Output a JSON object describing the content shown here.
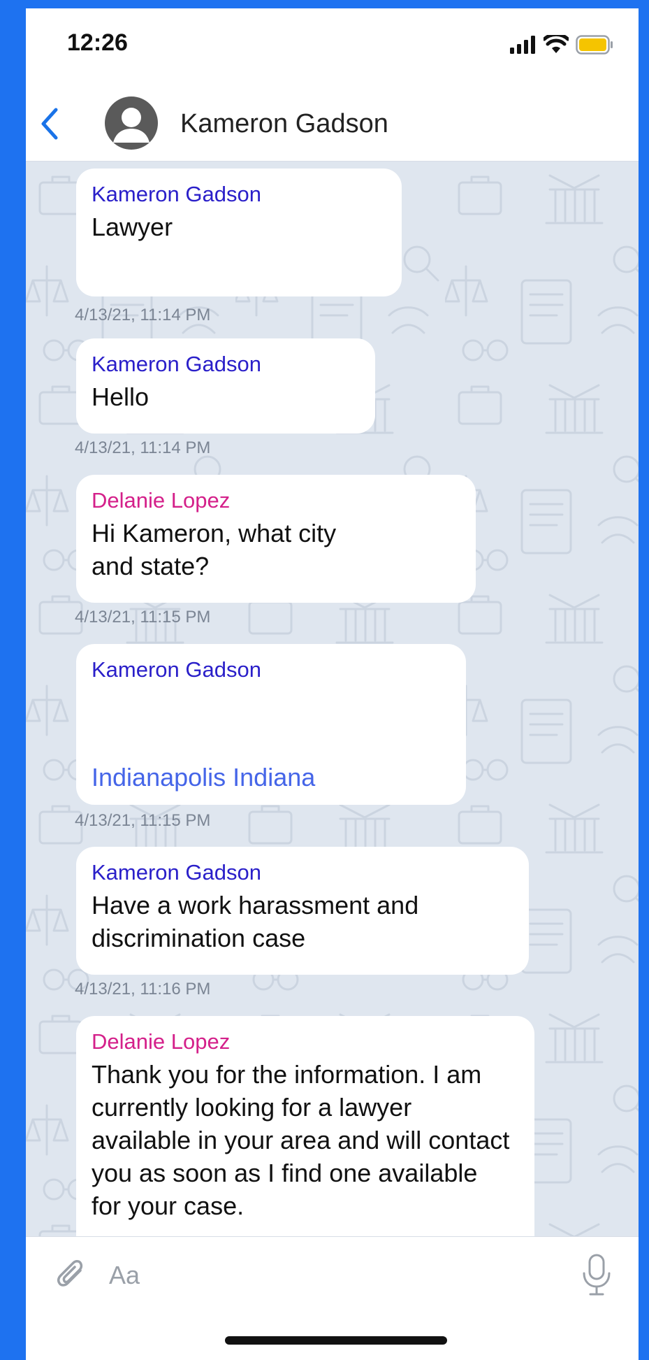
{
  "status_bar": {
    "time": "12:26"
  },
  "header": {
    "contact_name": "Kameron Gadson"
  },
  "messages": [
    {
      "sender": "Kameron Gadson",
      "text": "Lawyer",
      "timestamp": "4/13/21, 11:14 PM"
    },
    {
      "sender": "Kameron Gadson",
      "text": "Hello",
      "timestamp": "4/13/21, 11:14 PM"
    },
    {
      "sender": "Delanie Lopez",
      "text": "Hi Kameron, what city and state?",
      "timestamp": "4/13/21, 11:15 PM"
    },
    {
      "sender": "Kameron Gadson",
      "link_text": "Indianapolis Indiana",
      "timestamp": "4/13/21, 11:15 PM"
    },
    {
      "sender": "Kameron Gadson",
      "text": "Have a work harassment and discrimination case",
      "timestamp": "4/13/21, 11:16 PM"
    },
    {
      "sender": "Delanie Lopez",
      "text": "Thank you for the information. I am currently looking for a lawyer available in your area and will contact you as soon as I find one available for your case."
    }
  ],
  "input_bar": {
    "placeholder": "Aa"
  },
  "colors": {
    "page_background": "#1e72f0",
    "sender_kameron": "#2a1fc9",
    "sender_delanie": "#d4208a",
    "link": "#4565e8",
    "accent": "#1a73e8",
    "battery": "#f5c400"
  },
  "icons": {
    "back": "chevron-left-icon",
    "avatar": "person-avatar-icon",
    "attach": "paperclip-icon",
    "mic": "microphone-icon",
    "signal": "signal-icon",
    "wifi": "wifi-icon",
    "battery": "battery-icon"
  }
}
